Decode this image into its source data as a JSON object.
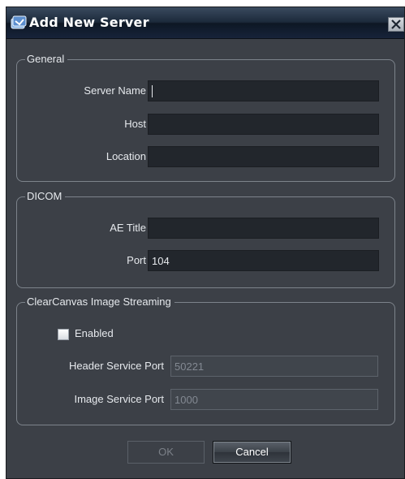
{
  "window": {
    "title": "Add New Server",
    "close_icon": "close-icon",
    "app_icon": "server-icon"
  },
  "general": {
    "legend": "General",
    "server_name_label": "Server Name",
    "server_name_value": "",
    "host_label": "Host",
    "host_value": "",
    "location_label": "Location",
    "location_value": ""
  },
  "dicom": {
    "legend": "DICOM",
    "ae_title_label": "AE Title",
    "ae_title_value": "",
    "port_label": "Port",
    "port_value": "104"
  },
  "streaming": {
    "legend": "ClearCanvas Image Streaming",
    "enabled_label": "Enabled",
    "enabled_checked": false,
    "header_port_label": "Header Service Port",
    "header_port_value": "50221",
    "image_port_label": "Image Service Port",
    "image_port_value": "1000"
  },
  "buttons": {
    "ok_label": "OK",
    "cancel_label": "Cancel"
  },
  "colors": {
    "window_bg": "#3c4047",
    "field_bg": "#22262c",
    "titlebar": "#0d1724"
  }
}
